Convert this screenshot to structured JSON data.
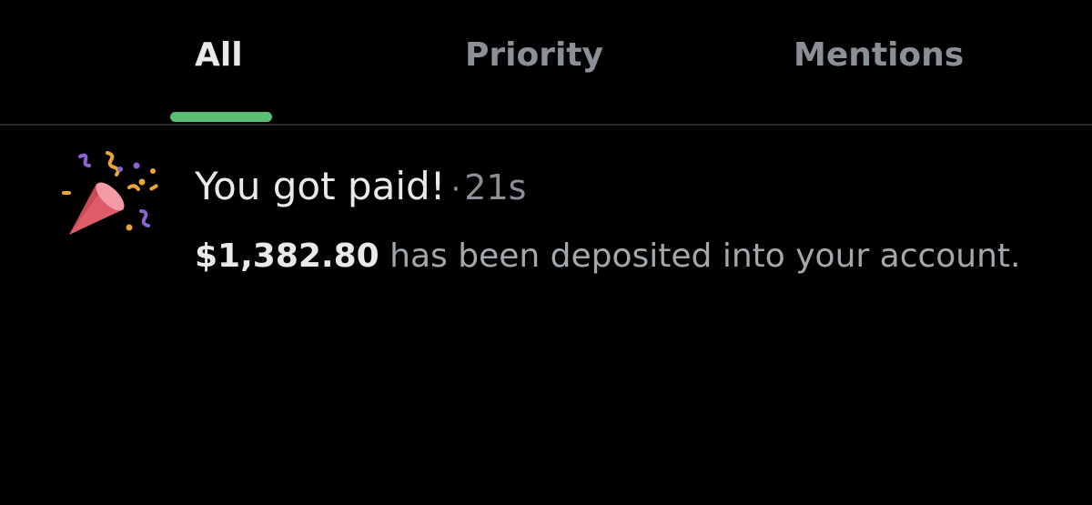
{
  "tabs": [
    {
      "label": "All",
      "active": true
    },
    {
      "label": "Priority",
      "active": false
    },
    {
      "label": "Mentions",
      "active": false
    }
  ],
  "colors": {
    "background": "#000000",
    "active_tab_text": "#e7e9ea",
    "inactive_tab_text": "#8b9096",
    "tab_indicator": "#5cbf74",
    "divider": "#262a2d"
  },
  "notification": {
    "icon": "party-popper-icon",
    "title": "You got paid!",
    "separator": "·",
    "time": "21s",
    "amount": "$1,382.80",
    "message": "has been deposited into your account."
  }
}
